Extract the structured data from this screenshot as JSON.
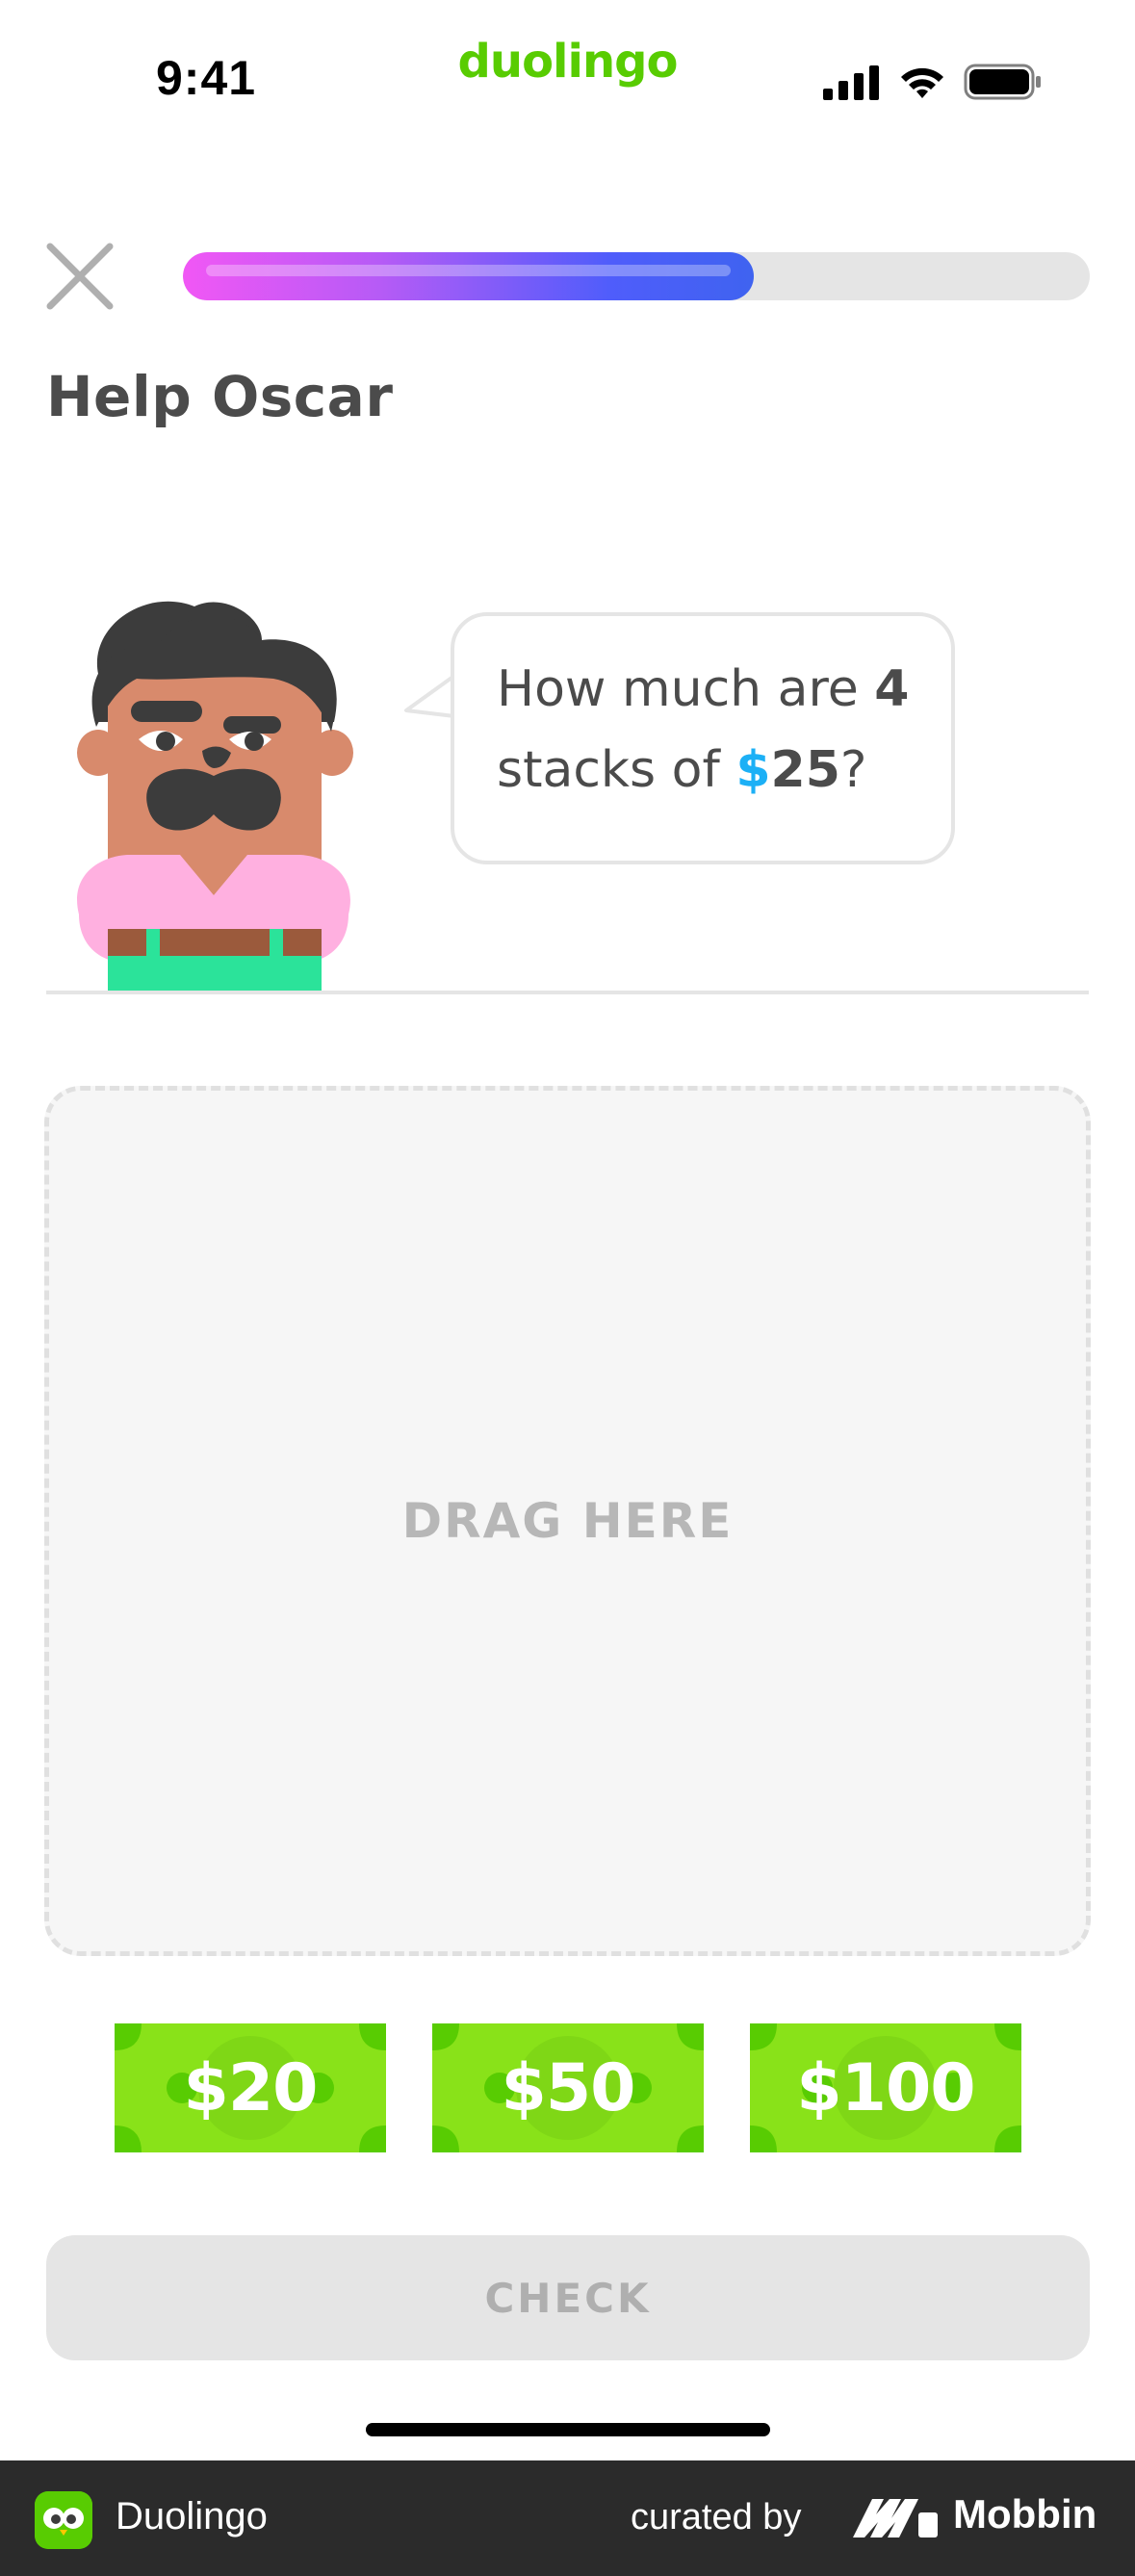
{
  "status_bar": {
    "time": "9:41",
    "brand": "duolingo",
    "icons": [
      "cellular-signal-icon",
      "wifi-icon",
      "battery-icon"
    ]
  },
  "lesson": {
    "close_icon": "close-icon",
    "progress_fraction": 0.63,
    "title": "Help Oscar",
    "character": "oscar"
  },
  "prompt": {
    "part1": "How much are ",
    "quantity": "4",
    "part2": "stacks of ",
    "currency": "$",
    "amount": "25",
    "end": "?"
  },
  "dropzone": {
    "label": "DRAG HERE"
  },
  "bills": [
    {
      "label": "$20"
    },
    {
      "label": "$50"
    },
    {
      "label": "$100"
    }
  ],
  "check_button": {
    "label": "CHECK",
    "enabled": false
  },
  "footer": {
    "app_name": "Duolingo",
    "curated_by": "curated by",
    "brand": "Mobbin"
  },
  "colors": {
    "brand_green": "#58cc02",
    "bill_green": "#58cc02",
    "progress_start": "#f157f5",
    "progress_end": "#3f63f0",
    "currency_blue": "#1cb0f6",
    "disabled_gray": "#e5e5e5"
  }
}
